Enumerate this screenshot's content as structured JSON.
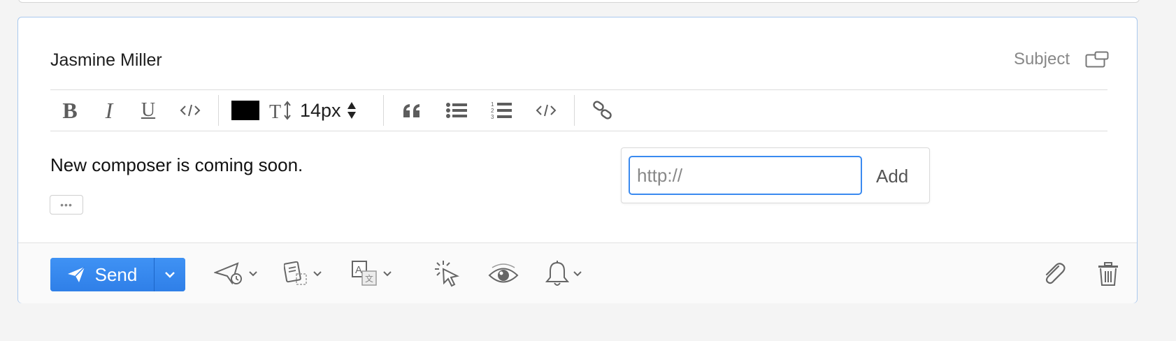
{
  "composer": {
    "recipient": "Jasmine Miller",
    "subject_label": "Subject",
    "body": "New composer is coming soon.",
    "more_label": "•••"
  },
  "toolbar": {
    "buttons": [
      "bold",
      "italic",
      "underline",
      "code",
      "text-color",
      "text-size",
      "quote",
      "bulleted-list",
      "numbered-list",
      "code-block",
      "link"
    ],
    "bold_label": "B",
    "italic_label": "I",
    "underline_label": "U",
    "text_size_icon_label": "T↕",
    "text_color": "#000000",
    "font_size": "14px"
  },
  "link_popup": {
    "placeholder": "http://",
    "value": "",
    "add_label": "Add"
  },
  "footer": {
    "send_label": "Send",
    "tools": [
      "send-later",
      "templates",
      "translate",
      "tracking",
      "read-receipt",
      "reminder",
      "attach",
      "delete"
    ]
  },
  "colors": {
    "accent": "#3a8af0",
    "border": "#a9c8ee",
    "background": "#f4f4f4"
  }
}
